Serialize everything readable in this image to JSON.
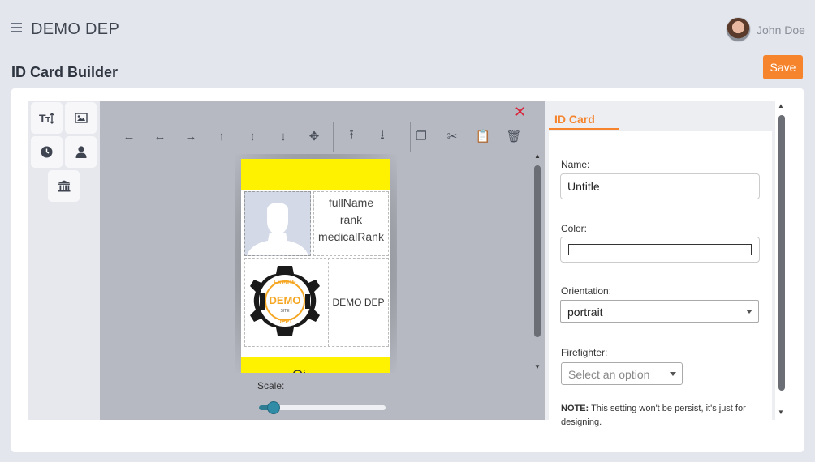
{
  "header": {
    "app_title": "DEMO DEP",
    "user_name": "John Doe"
  },
  "page": {
    "title": "ID Card Builder",
    "save_label": "Save"
  },
  "tools": [
    "text-size-tool",
    "image-tool",
    "clock-tool",
    "person-tool",
    "institution-tool"
  ],
  "canvas": {
    "close_symbol": "✕",
    "toolbar": [
      {
        "name": "align-left",
        "glyph": "←"
      },
      {
        "name": "align-center-horizontal",
        "glyph": "↔"
      },
      {
        "name": "align-right",
        "glyph": "→"
      },
      {
        "name": "align-top",
        "glyph": "↑"
      },
      {
        "name": "align-center-vertical",
        "glyph": "↕"
      },
      {
        "name": "align-bottom",
        "glyph": "↓"
      },
      {
        "name": "move",
        "glyph": "✥"
      },
      {
        "name": "upload",
        "glyph": "⭱"
      },
      {
        "name": "download",
        "glyph": "⭳"
      },
      {
        "name": "copy",
        "glyph": "❐"
      },
      {
        "name": "cut",
        "glyph": "✂"
      },
      {
        "name": "paste",
        "glyph": "📋"
      },
      {
        "name": "delete",
        "glyph": "🗑"
      }
    ],
    "card": {
      "full_name": "fullName",
      "rank": "rank",
      "medical_rank": "medicalRank",
      "department": "DEMO DEP",
      "bottom_text": "Oi",
      "logo": {
        "top": "FireIDE",
        "center": "DEMO",
        "sub": "SITE",
        "bottom": "DEPT"
      }
    },
    "scale_label": "Scale:",
    "scale_value": 0.1
  },
  "panel": {
    "tab": "ID Card",
    "name_label": "Name:",
    "name_value": "Untitle",
    "color_label": "Color:",
    "color_value": "#ffffff",
    "orientation_label": "Orientation:",
    "orientation_value": "portrait",
    "firefighter_label": "Firefighter:",
    "firefighter_placeholder": "Select an option",
    "note_bold": "NOTE:",
    "note_text": " This setting won't be persist, it's just for designing."
  },
  "colors": {
    "accent": "#f5842c",
    "card_band": "#fff200",
    "close": "#d9233b",
    "slider": "#2f8ba6"
  }
}
